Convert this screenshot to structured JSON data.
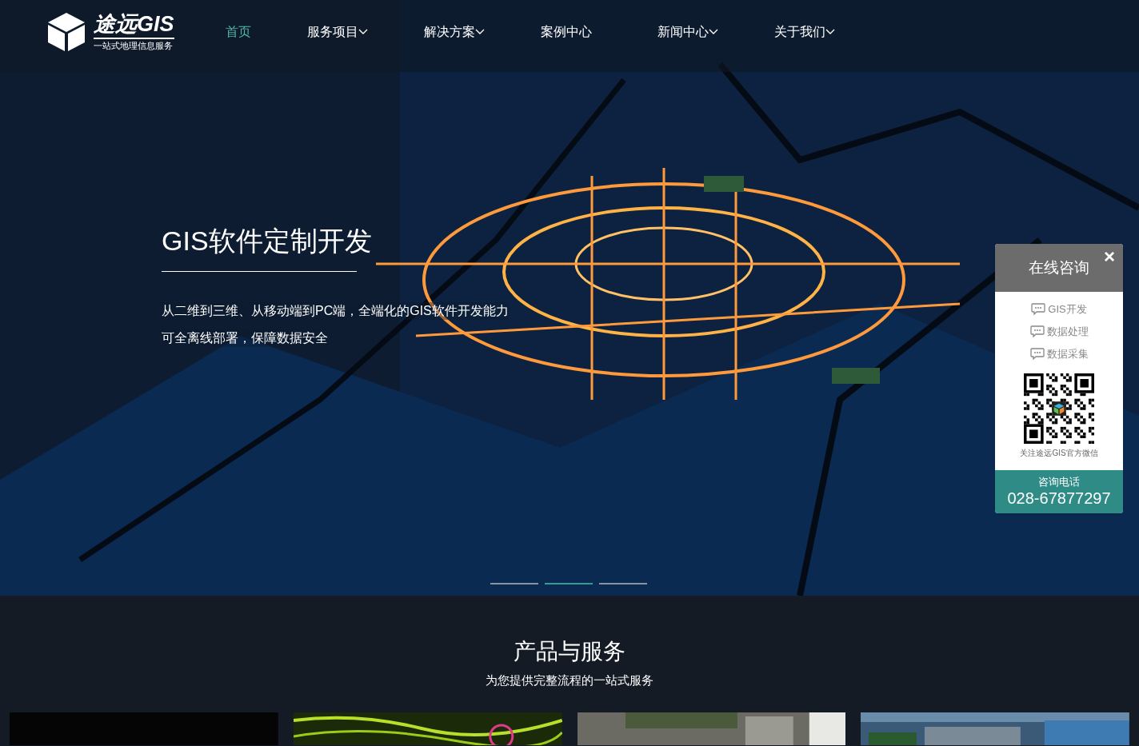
{
  "logo": {
    "name": "途远GIS",
    "tagline": "一站式地理信息服务"
  },
  "nav": [
    {
      "label": "首页",
      "selected": true,
      "dropdown": false
    },
    {
      "label": "服务项目",
      "selected": false,
      "dropdown": true
    },
    {
      "label": "解决方案",
      "selected": false,
      "dropdown": true
    },
    {
      "label": "案例中心",
      "selected": false,
      "dropdown": false
    },
    {
      "label": "新闻中心",
      "selected": false,
      "dropdown": true
    },
    {
      "label": "关于我们",
      "selected": false,
      "dropdown": true
    }
  ],
  "hero": {
    "title": "GIS软件定制开发",
    "lines": [
      "从二维到三维、从移动端到PC端，全端化的GIS软件开发能力",
      "可全离线部署，保障数据安全"
    ],
    "slides": [
      {
        "selected": false
      },
      {
        "selected": true
      },
      {
        "selected": false
      }
    ]
  },
  "consult": {
    "title": "在线咨询",
    "close": "×",
    "topics": [
      "GIS开发",
      "数据处理",
      "数据采集"
    ],
    "qr_caption": "关注途远GIS官方微信",
    "phone_label": "咨询电话",
    "phone": "028-67877297"
  },
  "products": {
    "title": "产品与服务",
    "subtitle": "为您提供完整流程的一站式服务"
  }
}
